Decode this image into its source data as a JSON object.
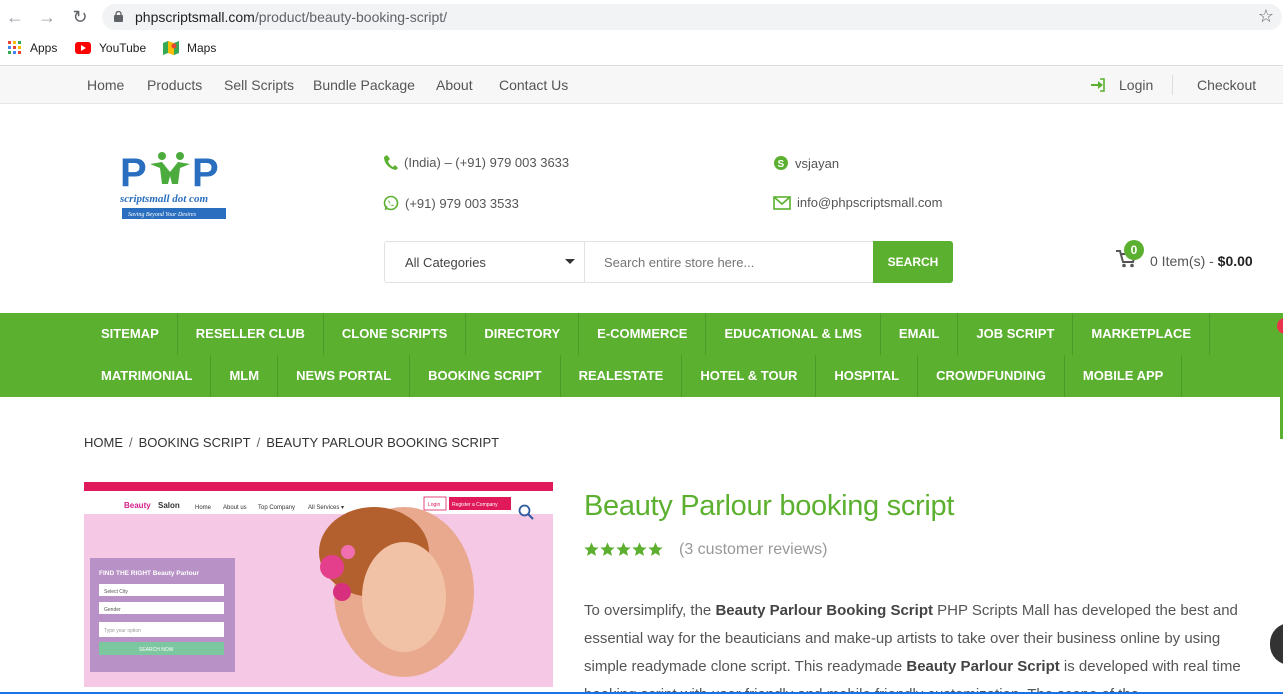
{
  "browser": {
    "url_domain": "phpscriptsmall.com",
    "url_path": "/product/beauty-booking-script/",
    "bookmarks": [
      {
        "label": "Apps",
        "icon": "apps-grid-icon"
      },
      {
        "label": "YouTube",
        "icon": "youtube-icon"
      },
      {
        "label": "Maps",
        "icon": "maps-icon"
      }
    ]
  },
  "topnav": {
    "links": [
      "Home",
      "Products",
      "Sell Scripts",
      "Bundle Package",
      "About",
      "Contact Us"
    ],
    "login": "Login",
    "checkout": "Checkout"
  },
  "header": {
    "logo_text": "PHP",
    "logo_sub": "scriptsmall dot com",
    "logo_tag": "Saving Beyond Your Desires",
    "phone_india": "(India) – (+91) 979 003 3633",
    "whatsapp": "(+91) 979 003 3533",
    "skype": "vsjayan",
    "email": "info@phpscriptsmall.com"
  },
  "search": {
    "category": "All Categories",
    "placeholder": "Search entire store here...",
    "button": "SEARCH"
  },
  "cart": {
    "count": "0",
    "items_label": "0 Item(s) - ",
    "total": "$0.00"
  },
  "category_menu": {
    "row1": [
      "SITEMAP",
      "RESELLER CLUB",
      "CLONE SCRIPTS",
      "DIRECTORY",
      "E-COMMERCE",
      "EDUCATIONAL & LMS",
      "EMAIL",
      "JOB SCRIPT",
      "MARKETPLACE"
    ],
    "row2": [
      "MATRIMONIAL",
      "MLM",
      "NEWS PORTAL",
      "BOOKING SCRIPT",
      "REALESTATE",
      "HOTEL & TOUR",
      "HOSPITAL",
      "CROWDFUNDING",
      "MOBILE APP"
    ]
  },
  "breadcrumb": [
    "HOME",
    "BOOKING SCRIPT",
    "BEAUTY PARLOUR BOOKING SCRIPT"
  ],
  "product": {
    "title": "Beauty Parlour booking script",
    "rating": 5,
    "reviews": "(3 customer reviews)",
    "desc_1": "To oversimplify, the ",
    "desc_b1": "Beauty Parlour Booking Script",
    "desc_2": " PHP Scripts Mall has developed the best and essential way for the beauticians and make-up artists to take over their business online by using simple readymade clone script. This readymade ",
    "desc_b2": "Beauty Parlour Script",
    "desc_3": " is developed with real time booking script with user friendly and mobile friendly customization. The scope of the"
  },
  "product_image": {
    "brand": "Beauty",
    "brand2": "Salon",
    "nav": [
      "Home",
      "About us",
      "Top Company",
      "All Services ▾"
    ],
    "login": "Login",
    "register": "Register a Company",
    "finder_title": "FIND THE RIGHT Beauty Parlour",
    "select_city": "Select City",
    "gender": "Gender",
    "type_option": "Type your option",
    "search_now": "SEARCH NOW"
  },
  "colors": {
    "brand_green": "#5cb02f",
    "text": "#555555"
  }
}
